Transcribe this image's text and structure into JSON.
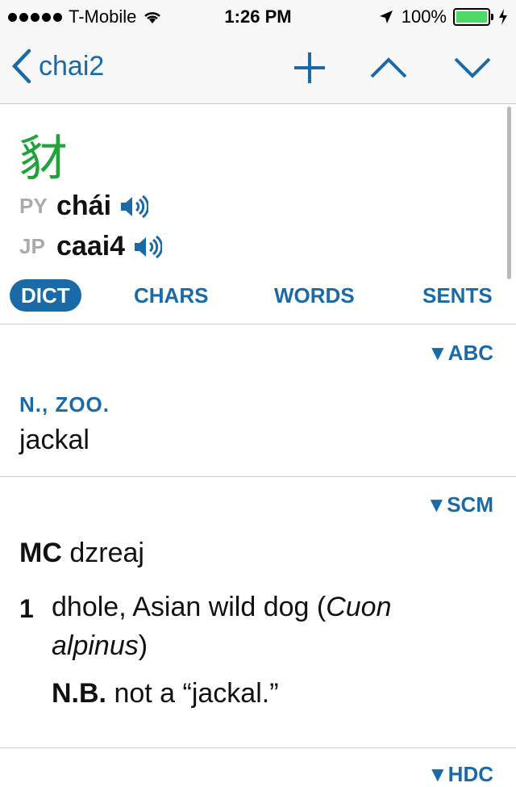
{
  "status": {
    "carrier": "T-Mobile",
    "time": "1:26 PM",
    "battery": "100%",
    "battery_level": 1.0
  },
  "nav": {
    "back_label": "chai2",
    "icons": [
      "chevron-left-icon",
      "plus-icon",
      "chevron-up-icon",
      "chevron-down-icon"
    ]
  },
  "entry": {
    "headword": "豺",
    "py_tag": "PY",
    "py_value": "chái",
    "jp_tag": "JP",
    "jp_value": "caai4"
  },
  "tabs": {
    "dict": "DICT",
    "chars": "CHARS",
    "words": "WORDS",
    "sents": "SENTS",
    "active": "DICT"
  },
  "sections": {
    "abc": {
      "source": "▼ABC",
      "pos": "N., ZOO.",
      "gloss": "jackal"
    },
    "scm": {
      "source": "▼SCM",
      "mc_label": "MC",
      "mc_value": "dzreaj",
      "sense_number": "1",
      "sense_text": "dhole, Asian wild dog (",
      "sense_latin": "Cuon alpinus",
      "sense_close": ")",
      "nb_label": "N.B.",
      "nb_text": "not a “jackal.”"
    },
    "hdc": {
      "source": "▼HDC"
    }
  },
  "colors": {
    "accent": "#1a6aa8",
    "headword": "#21a33b",
    "tag_gray": "#aaaaaa",
    "battery": "#4cd964"
  }
}
